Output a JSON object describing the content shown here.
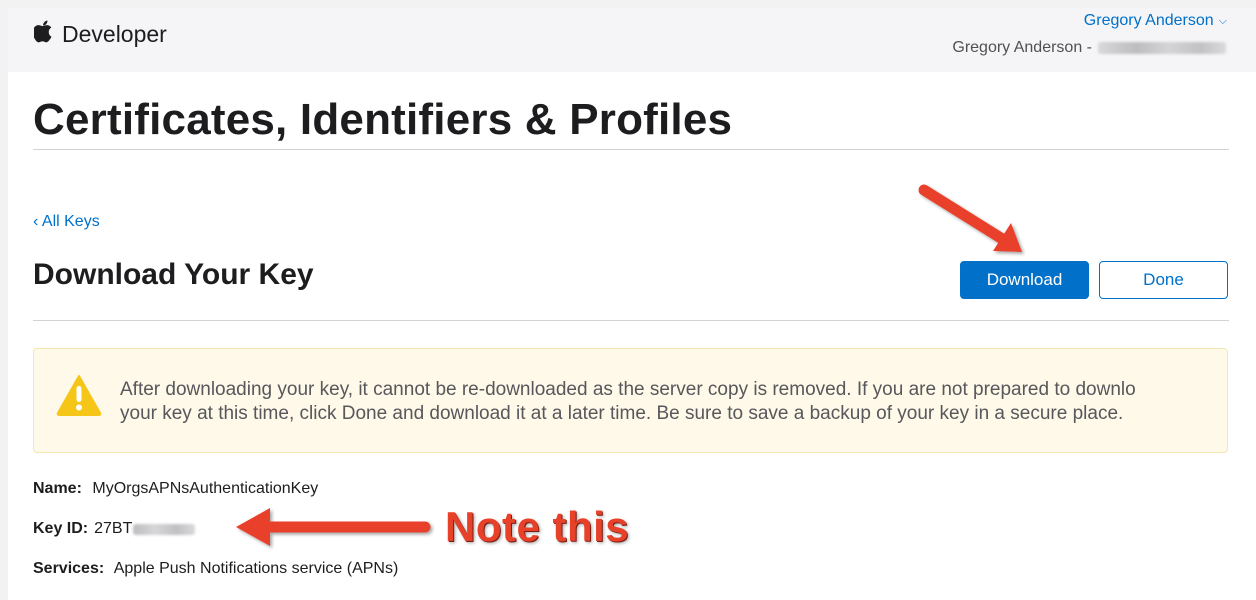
{
  "header": {
    "brand_text": "Developer",
    "brand_icon": "apple-logo-icon",
    "user_name": "Gregory Anderson",
    "team_prefix": "Gregory Anderson -"
  },
  "page": {
    "title": "Certificates, Identifiers & Profiles",
    "back_link": "All Keys",
    "back_chevron": "‹",
    "section_title": "Download Your Key"
  },
  "actions": {
    "download_label": "Download",
    "done_label": "Done"
  },
  "alert": {
    "icon": "warning-icon",
    "line1": "After downloading your key, it cannot be re-downloaded as the server copy is removed. If you are not prepared to downlo",
    "line2": "your key at this time, click Done and download it at a later time. Be sure to save a backup of your key in a secure place."
  },
  "key_info": {
    "name_label": "Name:",
    "name_value": "MyOrgsAPNsAuthenticationKey",
    "keyid_label": "Key ID:",
    "keyid_value": "27BT",
    "services_label": "Services:",
    "services_value": "Apple Push Notifications service (APNs)"
  },
  "annotation": {
    "note_text": "Note this",
    "arrow_color": "#e8412a"
  },
  "colors": {
    "accent": "#0070c9",
    "warning": "#f5c518",
    "alert_bg": "#fef9e8"
  }
}
